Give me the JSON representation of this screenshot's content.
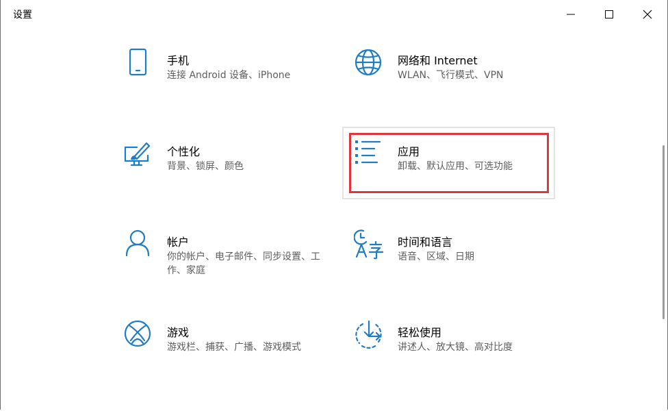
{
  "window": {
    "title": "设置"
  },
  "tiles": [
    {
      "label": "手机",
      "desc": "连接 Android 设备、iPhone",
      "icon": "phone-icon"
    },
    {
      "label": "网络和 Internet",
      "desc": "WLAN、飞行模式、VPN",
      "icon": "globe-icon"
    },
    {
      "label": "个性化",
      "desc": "背景、锁屏、颜色",
      "icon": "paintbrush-icon"
    },
    {
      "label": "应用",
      "desc": "卸载、默认应用、可选功能",
      "icon": "apps-list-icon"
    },
    {
      "label": "帐户",
      "desc": "你的帐户、电子邮件、同步设置、工作、家庭",
      "icon": "person-icon"
    },
    {
      "label": "时间和语言",
      "desc": "语音、区域、日期",
      "icon": "time-language-icon"
    },
    {
      "label": "游戏",
      "desc": "游戏栏、捕获、广播、游戏模式",
      "icon": "xbox-icon"
    },
    {
      "label": "轻松使用",
      "desc": "讲述人、放大镜、高对比度",
      "icon": "ease-of-access-icon"
    }
  ],
  "colors": {
    "accent": "#1e7bc4",
    "highlight": "#e0353a"
  }
}
